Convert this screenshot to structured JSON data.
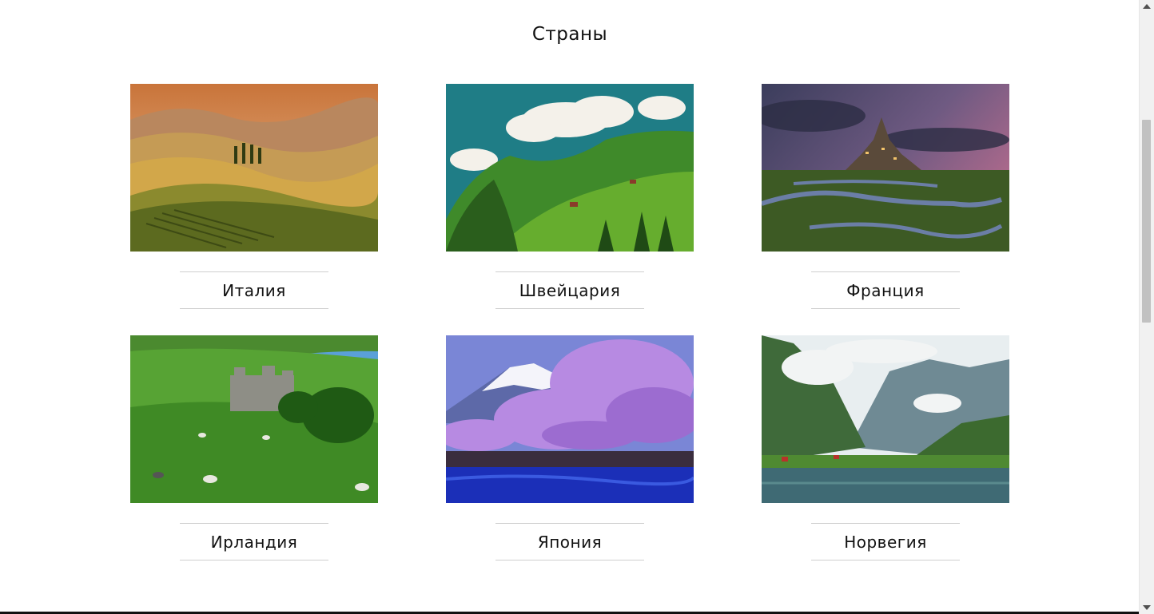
{
  "section": {
    "title": "Страны"
  },
  "countries": [
    {
      "name": "Италия",
      "image": "tuscany-hills-photo"
    },
    {
      "name": "Швейцария",
      "image": "swiss-alps-meadow-photo"
    },
    {
      "name": "Франция",
      "image": "mont-saint-michel-photo"
    },
    {
      "name": "Ирландия",
      "image": "irish-castle-sheep-photo"
    },
    {
      "name": "Япония",
      "image": "fuji-sakura-photo"
    },
    {
      "name": "Норвегия",
      "image": "norway-fjord-photo"
    }
  ]
}
